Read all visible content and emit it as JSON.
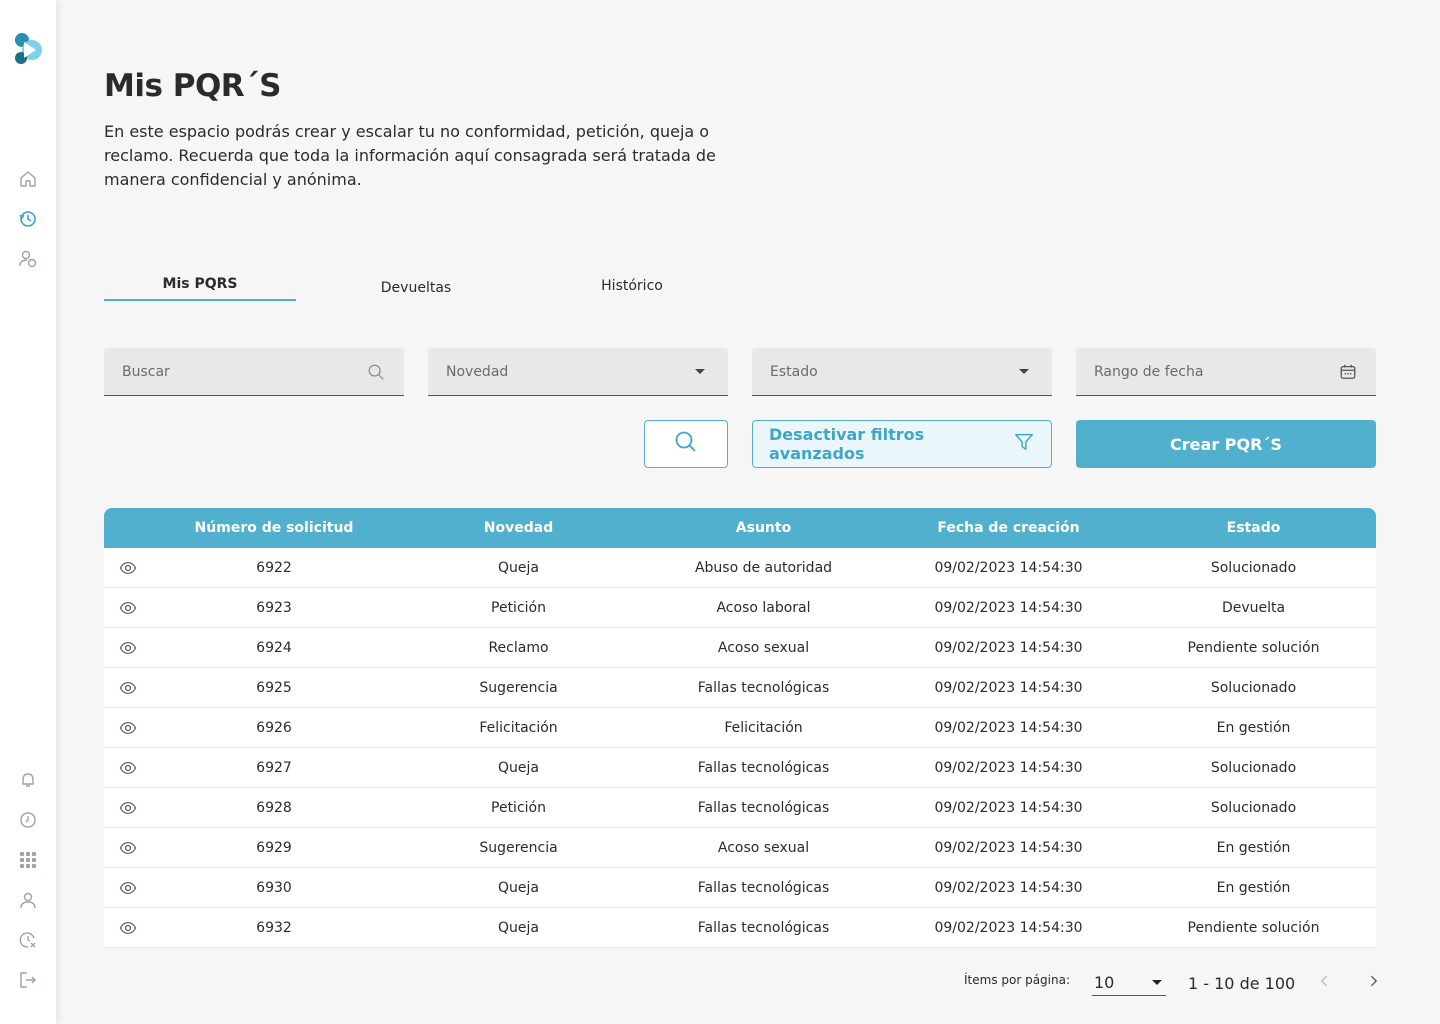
{
  "page": {
    "title": "Mis PQR´S",
    "description": "En este espacio podrás crear y escalar tu no conformidad, petición, queja o reclamo. Recuerda que toda la información aquí consagrada será tratada de manera confidencial y anónima."
  },
  "tabs": [
    {
      "label": "Mis PQRS",
      "active": true
    },
    {
      "label": "Devueltas",
      "active": false
    },
    {
      "label": "Histórico",
      "active": false
    }
  ],
  "filters": {
    "search_placeholder": "Buscar",
    "novedad_label": "Novedad",
    "estado_label": "Estado",
    "fecha_label": "Rango de fecha"
  },
  "buttons": {
    "filters_label": "Desactivar filtros avanzados",
    "create_label": "Crear PQR´S"
  },
  "table": {
    "headers": [
      "Número de solicitud",
      "Novedad",
      "Asunto",
      "Fecha de creación",
      "Estado"
    ],
    "rows": [
      {
        "numero": "6922",
        "novedad": "Queja",
        "asunto": "Abuso de autoridad",
        "fecha": "09/02/2023 14:54:30",
        "estado": "Solucionado"
      },
      {
        "numero": "6923",
        "novedad": "Petición",
        "asunto": "Acoso laboral",
        "fecha": "09/02/2023 14:54:30",
        "estado": "Devuelta"
      },
      {
        "numero": "6924",
        "novedad": "Reclamo",
        "asunto": "Acoso sexual",
        "fecha": "09/02/2023 14:54:30",
        "estado": "Pendiente solución"
      },
      {
        "numero": "6925",
        "novedad": "Sugerencia",
        "asunto": "Fallas tecnológicas",
        "fecha": "09/02/2023 14:54:30",
        "estado": "Solucionado"
      },
      {
        "numero": "6926",
        "novedad": "Felicitación",
        "asunto": "Felicitación",
        "fecha": "09/02/2023 14:54:30",
        "estado": "En gestión"
      },
      {
        "numero": "6927",
        "novedad": "Queja",
        "asunto": "Fallas tecnológicas",
        "fecha": "09/02/2023 14:54:30",
        "estado": "Solucionado"
      },
      {
        "numero": "6928",
        "novedad": "Petición",
        "asunto": "Fallas tecnológicas",
        "fecha": "09/02/2023 14:54:30",
        "estado": "Solucionado"
      },
      {
        "numero": "6929",
        "novedad": "Sugerencia",
        "asunto": "Acoso sexual",
        "fecha": "09/02/2023 14:54:30",
        "estado": "En gestión"
      },
      {
        "numero": "6930",
        "novedad": "Queja",
        "asunto": "Fallas tecnológicas",
        "fecha": "09/02/2023 14:54:30",
        "estado": "En gestión"
      },
      {
        "numero": "6932",
        "novedad": "Queja",
        "asunto": "Fallas tecnológicas",
        "fecha": "09/02/2023 14:54:30",
        "estado": "Pendiente solución"
      }
    ]
  },
  "pagination": {
    "items_label": "Ítems por página:",
    "per_page": "10",
    "range": "1 - 10 de 100"
  },
  "sidebar": {
    "top_icons": [
      "home-icon",
      "history-icon",
      "user-settings-icon"
    ],
    "bottom_icons": [
      "bell-icon",
      "clock-icon",
      "apps-grid-icon",
      "user-icon",
      "clock-cancel-icon",
      "logout-icon"
    ]
  },
  "colors": {
    "accent": "#52b0cf",
    "background": "#f6f6f6"
  }
}
